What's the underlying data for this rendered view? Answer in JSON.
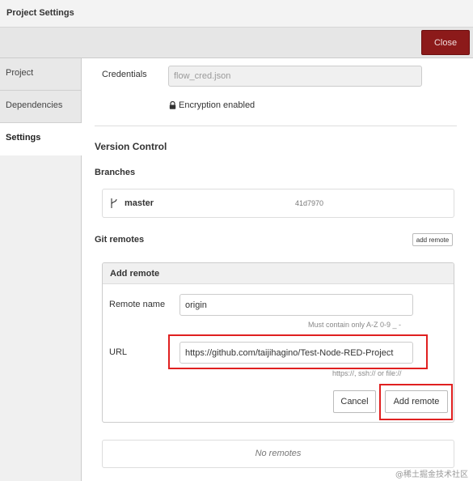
{
  "dialog": {
    "title": "Project Settings",
    "close_label": "Close"
  },
  "tabs": [
    "Project",
    "Dependencies",
    "Settings"
  ],
  "credentials": {
    "label": "Credentials",
    "value": "flow_cred.json",
    "encryption_status": "Encryption enabled"
  },
  "version_control": {
    "heading": "Version Control",
    "branches": {
      "heading": "Branches",
      "name": "master",
      "commit": "41d7970"
    },
    "git_remotes": {
      "heading": "Git remotes",
      "add_remote_small_label": "add remote"
    }
  },
  "add_remote": {
    "heading": "Add remote",
    "name_label": "Remote name",
    "name_value": "origin",
    "name_hint": "Must contain only A-Z 0-9 _ -",
    "url_label": "URL",
    "url_value": "https://github.com/taijihagino/Test-Node-RED-Project",
    "url_hint": "https://, ssh:// or file://",
    "cancel_label": "Cancel",
    "submit_label": "Add remote"
  },
  "remotes_empty": "No remotes",
  "watermark": "@稀土掘金技术社区",
  "colors": {
    "close_button": "#8c1a1a",
    "highlight": "#e02020"
  }
}
